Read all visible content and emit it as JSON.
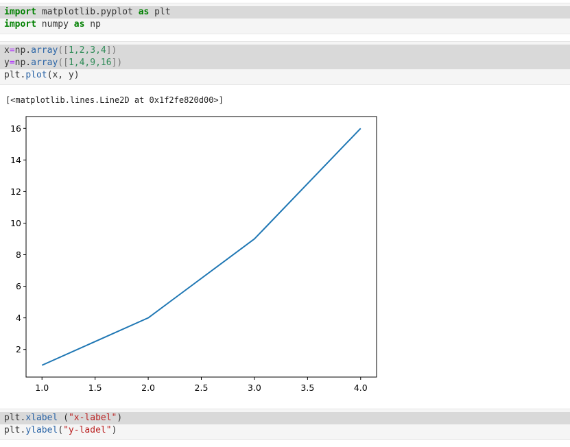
{
  "cells": {
    "cell1": {
      "line1": {
        "kw1": "import",
        "mod": " matplotlib.pyplot ",
        "kw2": "as",
        "alias": " plt"
      },
      "line2": {
        "kw1": "import",
        "mod": " numpy ",
        "kw2": "as",
        "alias": " np"
      }
    },
    "cell2": {
      "line1": {
        "var": "x",
        "eq": "=",
        "obj": "np.",
        "fn": "array",
        "open": "([",
        "vals": "1,2,3,4",
        "close": "])"
      },
      "line2": {
        "var": "y",
        "eq": "=",
        "obj": "np.",
        "fn": "array",
        "open": "([",
        "vals": "1,4,9,16",
        "close": "])"
      },
      "line3": {
        "obj": "plt.",
        "fn": "plot",
        "args": "(x, y)"
      }
    },
    "cell3": {
      "line1": {
        "obj": "plt.",
        "fn": "xlabel",
        "mid": " (",
        "str": "\"x-label\"",
        "close": ")"
      },
      "line2": {
        "obj": "plt.",
        "fn": "ylabel",
        "mid": "(",
        "str": "\"y-ladel\"",
        "close": ")"
      }
    }
  },
  "output_text": "[<matplotlib.lines.Line2D at 0x1f2fe820d00>]",
  "chart_data": {
    "type": "line",
    "x": [
      1,
      2,
      3,
      4
    ],
    "series": [
      {
        "values": [
          1,
          4,
          9,
          16
        ],
        "color": "#1f77b4"
      }
    ],
    "xlim": [
      0.85,
      4.15
    ],
    "ylim": [
      0.25,
      16.75
    ],
    "xticks": [
      1.0,
      1.5,
      2.0,
      2.5,
      3.0,
      3.5,
      4.0
    ],
    "xtick_labels": [
      "1.0",
      "1.5",
      "2.0",
      "2.5",
      "3.0",
      "3.5",
      "4.0"
    ],
    "yticks": [
      2,
      4,
      6,
      8,
      10,
      12,
      14,
      16
    ],
    "ytick_labels": [
      "2",
      "4",
      "6",
      "8",
      "10",
      "12",
      "14",
      "16"
    ],
    "grid": false,
    "title": "",
    "xlabel": "",
    "ylabel": ""
  }
}
